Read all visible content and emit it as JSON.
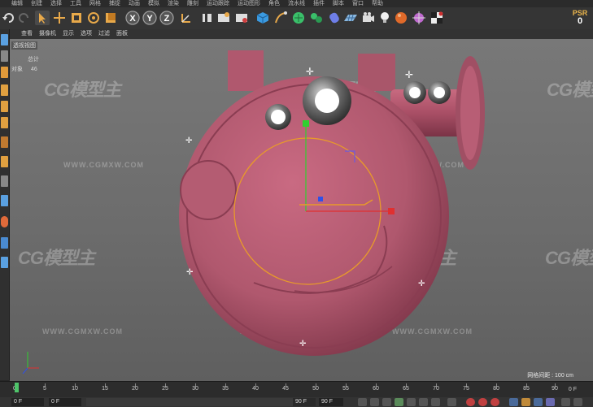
{
  "menu": [
    "编辑",
    "创建",
    "选择",
    "工具",
    "网格",
    "捕捉",
    "动画",
    "模拟",
    "渲染",
    "雕刻",
    "运动跟踪",
    "运动图形",
    "角色",
    "流水线",
    "插件",
    "脚本",
    "窗口",
    "帮助"
  ],
  "toolbar": {
    "axis_x": "X",
    "axis_y": "Y",
    "axis_z": "Z",
    "psr_label": "PSR",
    "psr_value": "0"
  },
  "viewport_menu": [
    "查看",
    "摄像机",
    "显示",
    "选项",
    "过滤",
    "面板"
  ],
  "viewport": {
    "name": "透视视图",
    "stats_header": "总计",
    "stats_label": "对象",
    "stats_value": "46",
    "grid_spacing": "网格间距 : 100 cm",
    "watermark_logo": "CG模型主",
    "watermark_url": "WWW.CGMXW.COM"
  },
  "timeline": {
    "ticks": [
      "0",
      "5",
      "10",
      "15",
      "20",
      "25",
      "30",
      "35",
      "40",
      "45",
      "50",
      "55",
      "60",
      "65",
      "70",
      "75",
      "80",
      "85",
      "90"
    ],
    "end_frame": "0 F"
  },
  "transport": {
    "current_frame": "0 F",
    "start_frame": "0 F",
    "end_frame": "90 F",
    "preview_end": "90 F"
  },
  "colors": {
    "object_body": "#b0586e",
    "selection_orange": "#e89a2a",
    "axis_x": "#e03030",
    "axis_y": "#30d030",
    "axis_z": "#3050e8"
  }
}
